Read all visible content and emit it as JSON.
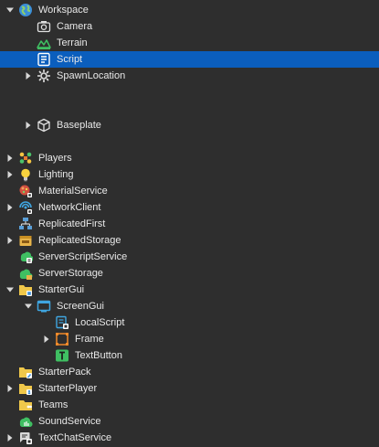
{
  "tree": {
    "rows": [
      {
        "label": "Workspace",
        "icon": "globe-icon",
        "depth": 0,
        "arrow": "expanded"
      },
      {
        "label": "Camera",
        "icon": "camera-icon",
        "depth": 1,
        "arrow": "none"
      },
      {
        "label": "Terrain",
        "icon": "terrain-icon",
        "depth": 1,
        "arrow": "none"
      },
      {
        "label": "Script",
        "icon": "script-icon",
        "depth": 1,
        "arrow": "none",
        "selected": true
      },
      {
        "label": "SpawnLocation",
        "icon": "spawn-gear-icon",
        "depth": 1,
        "arrow": "collapsed"
      },
      {
        "label": "",
        "icon": "",
        "depth": 1,
        "arrow": "none",
        "blank": true
      },
      {
        "label": "",
        "icon": "",
        "depth": 1,
        "arrow": "none",
        "blank": true
      },
      {
        "label": "Baseplate",
        "icon": "part-cube-icon",
        "depth": 1,
        "arrow": "collapsed"
      },
      {
        "label": "",
        "icon": "",
        "depth": 0,
        "arrow": "none",
        "blank": true
      },
      {
        "label": "Players",
        "icon": "players-icon",
        "depth": 0,
        "arrow": "collapsed"
      },
      {
        "label": "Lighting",
        "icon": "lightbulb-icon",
        "depth": 0,
        "arrow": "collapsed"
      },
      {
        "label": "MaterialService",
        "icon": "material-service-icon",
        "depth": 0,
        "arrow": "none"
      },
      {
        "label": "NetworkClient",
        "icon": "network-client-icon",
        "depth": 0,
        "arrow": "collapsed"
      },
      {
        "label": "ReplicatedFirst",
        "icon": "replicated-first-icon",
        "depth": 0,
        "arrow": "none"
      },
      {
        "label": "ReplicatedStorage",
        "icon": "replicated-storage-icon",
        "depth": 0,
        "arrow": "collapsed"
      },
      {
        "label": "ServerScriptService",
        "icon": "server-script-service-icon",
        "depth": 0,
        "arrow": "none"
      },
      {
        "label": "ServerStorage",
        "icon": "server-storage-icon",
        "depth": 0,
        "arrow": "none"
      },
      {
        "label": "StarterGui",
        "icon": "starter-gui-folder-icon",
        "depth": 0,
        "arrow": "expanded"
      },
      {
        "label": "ScreenGui",
        "icon": "screen-gui-icon",
        "depth": 1,
        "arrow": "expanded"
      },
      {
        "label": "LocalScript",
        "icon": "local-script-icon",
        "depth": 2,
        "arrow": "none"
      },
      {
        "label": "Frame",
        "icon": "frame-icon",
        "depth": 2,
        "arrow": "collapsed"
      },
      {
        "label": "TextButton",
        "icon": "text-button-icon",
        "depth": 2,
        "arrow": "none"
      },
      {
        "label": "StarterPack",
        "icon": "starter-pack-folder-icon",
        "depth": 0,
        "arrow": "none"
      },
      {
        "label": "StarterPlayer",
        "icon": "starter-player-folder-icon",
        "depth": 0,
        "arrow": "collapsed"
      },
      {
        "label": "Teams",
        "icon": "teams-folder-icon",
        "depth": 0,
        "arrow": "none"
      },
      {
        "label": "SoundService",
        "icon": "sound-service-icon",
        "depth": 0,
        "arrow": "none"
      },
      {
        "label": "TextChatService",
        "icon": "text-chat-service-icon",
        "depth": 0,
        "arrow": "collapsed"
      }
    ]
  },
  "colors": {
    "background": "#2e2e2e",
    "selected": "#0b5ebd",
    "text": "#e8e8e8",
    "arrow": "#d8d8d8"
  }
}
